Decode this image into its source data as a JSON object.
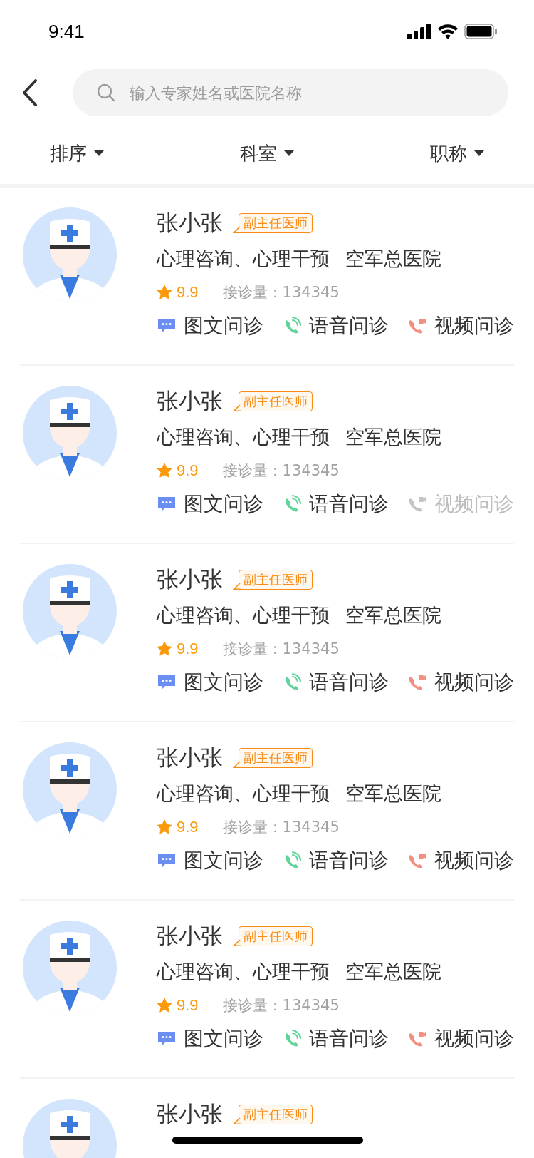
{
  "status_bar": {
    "time": "9:41"
  },
  "search": {
    "placeholder": "输入专家姓名或医院名称"
  },
  "filters": [
    {
      "label": "排序"
    },
    {
      "label": "科室"
    },
    {
      "label": "职称"
    }
  ],
  "doctors": [
    {
      "name": "张小张",
      "title": "副主任医师",
      "specialty": "心理咨询、心理干预",
      "hospital": "空军总医院",
      "rating": "9.9",
      "visits": "接诊量：134345",
      "services": [
        {
          "kind": "text",
          "label": "图文问诊",
          "disabled": false
        },
        {
          "kind": "voice",
          "label": "语音问诊",
          "disabled": false
        },
        {
          "kind": "video",
          "label": "视频问诊",
          "disabled": false
        }
      ]
    },
    {
      "name": "张小张",
      "title": "副主任医师",
      "specialty": "心理咨询、心理干预",
      "hospital": "空军总医院",
      "rating": "9.9",
      "visits": "接诊量：134345",
      "services": [
        {
          "kind": "text",
          "label": "图文问诊",
          "disabled": false
        },
        {
          "kind": "voice",
          "label": "语音问诊",
          "disabled": false
        },
        {
          "kind": "video",
          "label": "视频问诊",
          "disabled": true
        }
      ]
    },
    {
      "name": "张小张",
      "title": "副主任医师",
      "specialty": "心理咨询、心理干预",
      "hospital": "空军总医院",
      "rating": "9.9",
      "visits": "接诊量：134345",
      "services": [
        {
          "kind": "text",
          "label": "图文问诊",
          "disabled": false
        },
        {
          "kind": "voice",
          "label": "语音问诊",
          "disabled": false
        },
        {
          "kind": "video",
          "label": "视频问诊",
          "disabled": false
        }
      ]
    },
    {
      "name": "张小张",
      "title": "副主任医师",
      "specialty": "心理咨询、心理干预",
      "hospital": "空军总医院",
      "rating": "9.9",
      "visits": "接诊量：134345",
      "services": [
        {
          "kind": "text",
          "label": "图文问诊",
          "disabled": false
        },
        {
          "kind": "voice",
          "label": "语音问诊",
          "disabled": false
        },
        {
          "kind": "video",
          "label": "视频问诊",
          "disabled": false
        }
      ]
    },
    {
      "name": "张小张",
      "title": "副主任医师",
      "specialty": "心理咨询、心理干预",
      "hospital": "空军总医院",
      "rating": "9.9",
      "visits": "接诊量：134345",
      "services": [
        {
          "kind": "text",
          "label": "图文问诊",
          "disabled": false
        },
        {
          "kind": "voice",
          "label": "语音问诊",
          "disabled": false
        },
        {
          "kind": "video",
          "label": "视频问诊",
          "disabled": false
        }
      ]
    },
    {
      "name": "张小张",
      "title": "副主任医师"
    }
  ]
}
